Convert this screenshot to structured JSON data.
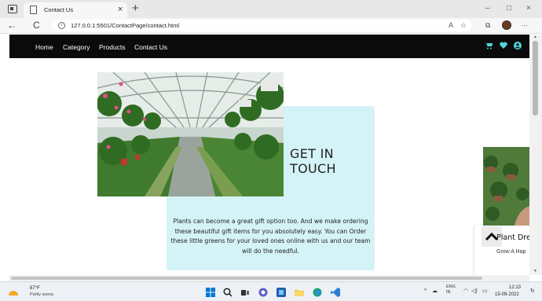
{
  "browser": {
    "tab_title": "Contact Us",
    "tab_close": "×",
    "new_tab": "+",
    "url": "127.0.0.1:5501/ContactPage/contact.html",
    "back": "←",
    "refresh": "C",
    "info": "i",
    "read_aloud": "A",
    "more": "···",
    "minimize": "–",
    "restore": "□",
    "close": "×"
  },
  "site_nav": {
    "links": [
      "Home",
      "Category",
      "Products",
      "Contact Us"
    ],
    "icons": [
      "cart-icon",
      "heart-icon",
      "user-icon"
    ],
    "accent_color": "#4fd6e0"
  },
  "contact": {
    "title_line1": "GET IN",
    "title_line2": "TOUCH",
    "text": "Plants can become a great gift option too. And we make ordering these beautiful gift items for you absolutely easy. You can Order these little greens for your loved ones online with us and our team will do the needful.",
    "card_color": "#d4f3f6"
  },
  "product_card": {
    "name": "Plant Dre",
    "subtitle": "Grow A Hap"
  },
  "taskbar": {
    "weather_temp": "87°F",
    "weather_cond": "Partly sunny",
    "lang_line1": "ENG",
    "lang_line2": "IN",
    "time": "12:13",
    "date": "15-09-2022"
  }
}
